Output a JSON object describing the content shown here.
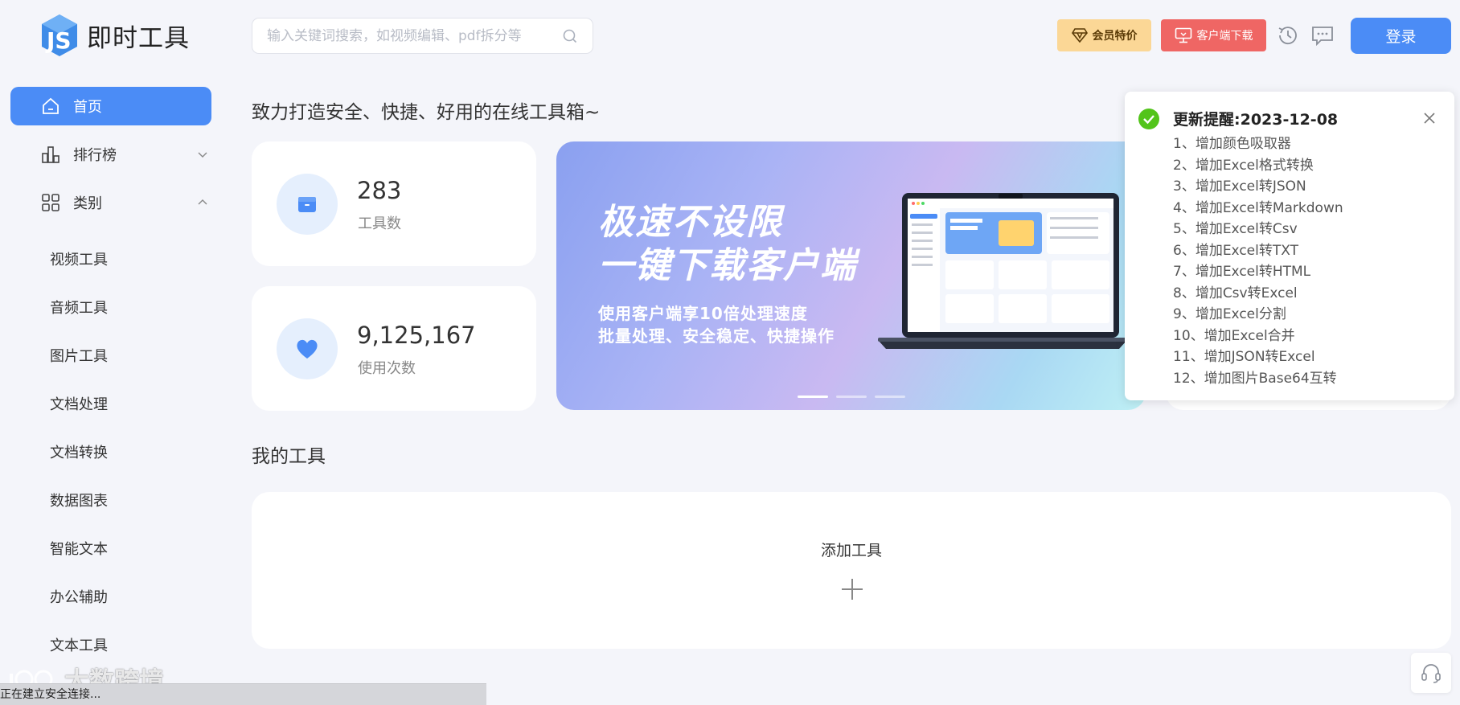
{
  "app": {
    "logo_text": "即时工具"
  },
  "header": {
    "search_placeholder": "输入关键词搜索，如视频编辑、pdf拆分等",
    "vip_label": "会员特价",
    "download_label": "客户端下载",
    "login_label": "登录"
  },
  "sidebar": {
    "home": "首页",
    "ranking": "排行榜",
    "category": "类别",
    "sub_items": [
      "视频工具",
      "音频工具",
      "图片工具",
      "文档处理",
      "文档转换",
      "数据图表",
      "智能文本",
      "办公辅助",
      "文本工具"
    ]
  },
  "main": {
    "tagline": "致力打造安全、快捷、好用的在线工具箱~",
    "stats": [
      {
        "value": "283",
        "label": "工具数",
        "icon": "box-icon"
      },
      {
        "value": "9,125,167",
        "label": "使用次数",
        "icon": "heart-icon"
      }
    ],
    "banner": {
      "line1": "极速不设限",
      "line2": "一键下载客户端",
      "sub1": "使用客户端享10倍处理速度",
      "sub2": "批量处理、安全稳定、快捷操作",
      "slides": 3,
      "active_slide": 1
    },
    "my_tools_title": "我的工具",
    "add_tool_label": "添加工具"
  },
  "notification": {
    "title": "更新提醒:2023-12-08",
    "items": [
      "1、增加颜色吸取器",
      "2、增加Excel格式转换",
      "3、增加Excel转JSON",
      "4、增加Excel转Markdown",
      "5、增加Excel转Csv",
      "6、增加Excel转TXT",
      "7、增加Excel转HTML",
      "8、增加Csv转Excel",
      "9、增加Excel分割",
      "10、增加Excel合并",
      "11、增加JSON转Excel",
      "12、增加图片Base64互转"
    ]
  },
  "watermark": "大数跨境",
  "statusbar": "正在建立安全连接...",
  "colors": {
    "primary": "#4b8cf6",
    "vip": "#fbd796",
    "download": "#ef6664",
    "success": "#52c41a"
  }
}
